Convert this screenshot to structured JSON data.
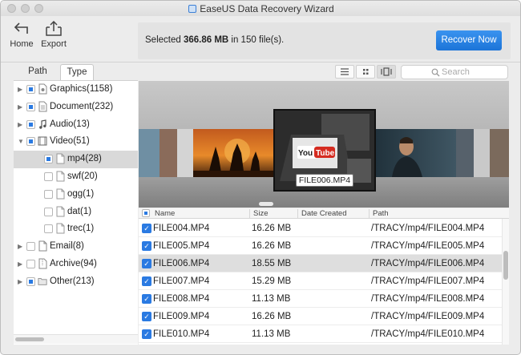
{
  "window": {
    "title": "EaseUS Data Recovery Wizard"
  },
  "toolbar": {
    "home_label": "Home",
    "export_label": "Export",
    "selection_prefix": "Selected ",
    "selection_size": "366.86 MB",
    "selection_suffix": " in 150 file(s).",
    "recover_label": "Recover Now"
  },
  "left_tabs": {
    "path_label": "Path",
    "type_label": "Type",
    "active": "Type"
  },
  "tree": [
    {
      "label": "Graphics(1158)",
      "level": 0,
      "expanded": false,
      "checked": "partial",
      "icon": "graphics-icon"
    },
    {
      "label": "Document(232)",
      "level": 0,
      "expanded": false,
      "checked": "partial",
      "icon": "document-icon"
    },
    {
      "label": "Audio(13)",
      "level": 0,
      "expanded": false,
      "checked": "partial",
      "icon": "music-icon"
    },
    {
      "label": "Video(51)",
      "level": 0,
      "expanded": true,
      "checked": "partial",
      "icon": "video-icon"
    },
    {
      "label": "mp4(28)",
      "level": 1,
      "checked": "partial",
      "icon": "file-icon",
      "selected": true
    },
    {
      "label": "swf(20)",
      "level": 1,
      "checked": "none",
      "icon": "file-icon"
    },
    {
      "label": "ogg(1)",
      "level": 1,
      "checked": "none",
      "icon": "file-icon"
    },
    {
      "label": "dat(1)",
      "level": 1,
      "checked": "none",
      "icon": "file-icon"
    },
    {
      "label": "trec(1)",
      "level": 1,
      "checked": "none",
      "icon": "file-icon"
    },
    {
      "label": "Email(8)",
      "level": 0,
      "expanded": false,
      "checked": "none",
      "icon": "email-icon"
    },
    {
      "label": "Archive(94)",
      "level": 0,
      "expanded": false,
      "checked": "none",
      "icon": "archive-icon"
    },
    {
      "label": "Other(213)",
      "level": 0,
      "expanded": false,
      "checked": "partial",
      "icon": "folder-icon"
    }
  ],
  "search": {
    "placeholder": "Search"
  },
  "preview": {
    "current_file": "FILE006.MP4",
    "center_logo_text": "YouTube"
  },
  "table": {
    "headers": {
      "name": "Name",
      "size": "Size",
      "date": "Date Created",
      "path": "Path"
    },
    "rows": [
      {
        "name": "FILE004.MP4",
        "size": "16.26 MB",
        "path": "/TRACY/mp4/FILE004.MP4",
        "selected": false
      },
      {
        "name": "FILE005.MP4",
        "size": "16.26 MB",
        "path": "/TRACY/mp4/FILE005.MP4",
        "selected": false
      },
      {
        "name": "FILE006.MP4",
        "size": "18.55 MB",
        "path": "/TRACY/mp4/FILE006.MP4",
        "selected": true
      },
      {
        "name": "FILE007.MP4",
        "size": "15.29 MB",
        "path": "/TRACY/mp4/FILE007.MP4",
        "selected": false
      },
      {
        "name": "FILE008.MP4",
        "size": "11.13 MB",
        "path": "/TRACY/mp4/FILE008.MP4",
        "selected": false
      },
      {
        "name": "FILE009.MP4",
        "size": "16.26 MB",
        "path": "/TRACY/mp4/FILE009.MP4",
        "selected": false
      },
      {
        "name": "FILE010.MP4",
        "size": "11.13 MB",
        "path": "/TRACY/mp4/FILE010.MP4",
        "selected": false
      }
    ]
  },
  "colors": {
    "accent": "#2a7ae2",
    "recover_button": "#1f78dc",
    "selection_bg": "#dedede"
  }
}
